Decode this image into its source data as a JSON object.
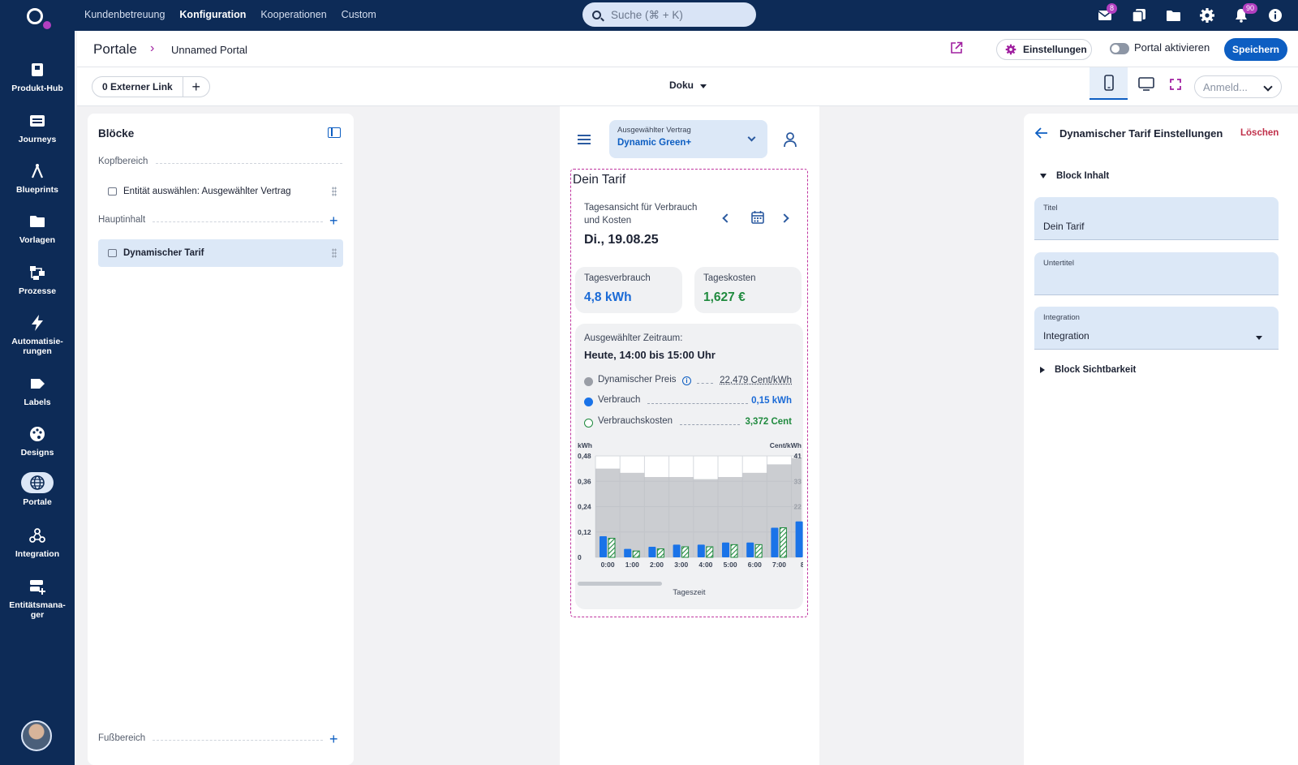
{
  "topnav": {
    "items": [
      "Kundenbetreuung",
      "Konfiguration",
      "Kooperationen",
      "Custom"
    ],
    "active": "Konfiguration",
    "search_placeholder": "Suche (⌘ + K)",
    "icons": [
      {
        "name": "mail-icon",
        "badge": "8"
      },
      {
        "name": "copy-icon",
        "badge": ""
      },
      {
        "name": "folder-icon",
        "badge": ""
      },
      {
        "name": "gear-icon",
        "badge": ""
      },
      {
        "name": "bell-icon",
        "badge": "90"
      },
      {
        "name": "info-icon",
        "badge": ""
      }
    ],
    "accent": "#0d2b57",
    "badge_color": "#b23fc0"
  },
  "sidebar": {
    "items": [
      {
        "label": "Produkt-Hub",
        "icon": "product-hub-icon"
      },
      {
        "label": "Journeys",
        "icon": "journeys-icon"
      },
      {
        "label": "Blueprints",
        "icon": "blueprints-icon"
      },
      {
        "label": "Vorlagen",
        "icon": "folder-icon"
      },
      {
        "label": "Prozesse",
        "icon": "process-icon"
      },
      {
        "label": "Automatisie-\nrungen",
        "icon": "lightning-icon"
      },
      {
        "label": "Labels",
        "icon": "label-icon"
      },
      {
        "label": "Designs",
        "icon": "palette-icon"
      },
      {
        "label": "Portale",
        "icon": "globe-icon"
      },
      {
        "label": "Integration",
        "icon": "webhook-icon"
      },
      {
        "label": "Entitätsmana-\nger",
        "icon": "entity-manager-icon"
      }
    ],
    "active": "Portale"
  },
  "header": {
    "breadcrumb_root": "Portale",
    "breadcrumb_page": "Unnamed Portal",
    "settings_label": "Einstellungen",
    "toggle_label": "Portal aktivieren",
    "save_label": "Speichern"
  },
  "toolbar": {
    "external_link_label": "0 Externer Link",
    "add_label": "+",
    "doc_select": "Doku",
    "login_select": "Anmeld..."
  },
  "blocks_panel": {
    "title": "Blöcke",
    "sections": {
      "header": "Kopfbereich",
      "main": "Hauptinhalt",
      "footer": "Fußbereich"
    },
    "header_blocks": [
      "Entität auswählen: Ausgewählter Vertrag"
    ],
    "main_blocks": [
      "Dynamischer Tarif"
    ]
  },
  "preview": {
    "contract_label": "Ausgewählter Vertrag",
    "contract_value": "Dynamic Green+",
    "block_title": "Dein Tarif",
    "day_label": "Tagesansicht für Verbrauch und Kosten",
    "day_date": "Di., 19.08.25",
    "consumption_label": "Tagesverbrauch",
    "consumption_value": "4,8 kWh",
    "cost_label": "Tageskosten",
    "cost_value": "1,627 €",
    "range_label": "Ausgewählter Zeitraum:",
    "range_value": "Heute, 14:00 bis 15:00 Uhr",
    "legend": [
      {
        "name": "Dynamischer Preis",
        "value": "22,479 Cent/kWh",
        "color": "#9a9ea6"
      },
      {
        "name": "Verbrauch",
        "value": "0,15 kWh",
        "color": "#1a73e8"
      },
      {
        "name": "Verbrauchskosten",
        "value": "3,372 Cent",
        "color": "#1f8a3e"
      }
    ],
    "x_axis_title": "Tageszeit"
  },
  "chart_data": {
    "type": "bar",
    "ylabel_left": "kWh",
    "ylabel_right": "Cent/kWh",
    "xlabel": "Tageszeit",
    "categories": [
      "0:00",
      "1:00",
      "2:00",
      "3:00",
      "4:00",
      "5:00",
      "6:00",
      "7:00",
      "8:"
    ],
    "y_ticks_left": [
      "0,48",
      "0,36",
      "0,24",
      "0,12",
      "0"
    ],
    "y_ticks_right": [
      "41",
      "33",
      "22",
      ""
    ],
    "ylim": [
      0,
      0.48
    ],
    "series": [
      {
        "name": "Verbrauch",
        "values": [
          0.1,
          0.04,
          0.05,
          0.06,
          0.06,
          0.07,
          0.07,
          0.14,
          0.17
        ]
      },
      {
        "name": "Verbrauchskosten",
        "values": [
          0.09,
          0.03,
          0.04,
          0.05,
          0.05,
          0.06,
          0.06,
          0.14,
          0
        ]
      },
      {
        "name": "Dynamischer Preis",
        "values": [
          0.42,
          0.4,
          0.38,
          0.38,
          0.37,
          0.38,
          0.4,
          0.44,
          0.47
        ]
      }
    ],
    "grid": true
  },
  "settings_panel": {
    "title": "Dynamischer Tarif Einstellungen",
    "delete_label": "Löschen",
    "content_section": "Block Inhalt",
    "visibility_section": "Block Sichtbarkeit",
    "fields": {
      "title_label": "Titel",
      "title_value": "Dein Tarif",
      "subtitle_label": "Untertitel",
      "subtitle_value": "",
      "integration_label": "Integration",
      "integration_value": "Integration"
    }
  }
}
